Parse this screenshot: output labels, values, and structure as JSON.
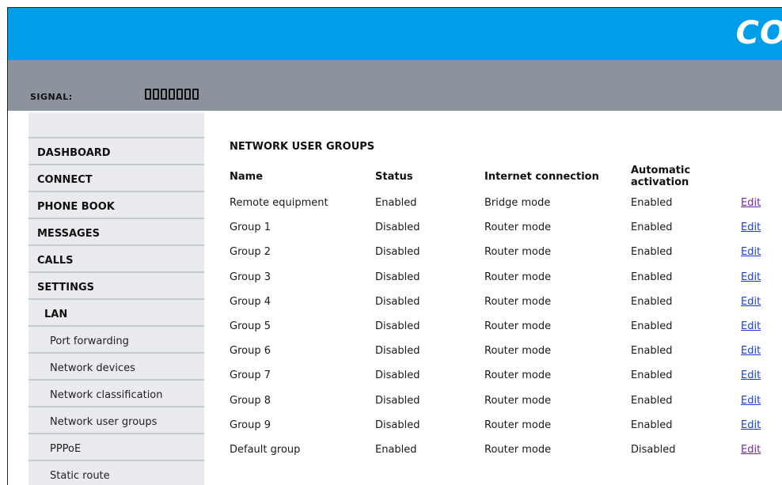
{
  "header": {
    "logo_text": "CO"
  },
  "signal": {
    "label": "SIGNAL:",
    "bars": 7
  },
  "sidebar": {
    "items": [
      {
        "label": "DASHBOARD",
        "level": 0
      },
      {
        "label": "CONNECT",
        "level": 0
      },
      {
        "label": "PHONE BOOK",
        "level": 0
      },
      {
        "label": "MESSAGES",
        "level": 0
      },
      {
        "label": "CALLS",
        "level": 0
      },
      {
        "label": "SETTINGS",
        "level": 0
      },
      {
        "label": "LAN",
        "level": 1
      },
      {
        "label": "Port forwarding",
        "level": 2
      },
      {
        "label": "Network devices",
        "level": 2
      },
      {
        "label": "Network classification",
        "level": 2
      },
      {
        "label": "Network user groups",
        "level": 2
      },
      {
        "label": "PPPoE",
        "level": 2
      },
      {
        "label": "Static route",
        "level": 2
      }
    ]
  },
  "main": {
    "title": "NETWORK USER GROUPS",
    "columns": [
      "Name",
      "Status",
      "Internet connection",
      "Automatic activation",
      ""
    ],
    "rows": [
      {
        "name": "Remote equipment",
        "status": "Enabled",
        "connection": "Bridge mode",
        "activation": "Enabled",
        "action": "Edit",
        "visited": true
      },
      {
        "name": "Group 1",
        "status": "Disabled",
        "connection": "Router mode",
        "activation": "Enabled",
        "action": "Edit",
        "visited": false
      },
      {
        "name": "Group 2",
        "status": "Disabled",
        "connection": "Router mode",
        "activation": "Enabled",
        "action": "Edit",
        "visited": false
      },
      {
        "name": "Group 3",
        "status": "Disabled",
        "connection": "Router mode",
        "activation": "Enabled",
        "action": "Edit",
        "visited": false
      },
      {
        "name": "Group 4",
        "status": "Disabled",
        "connection": "Router mode",
        "activation": "Enabled",
        "action": "Edit",
        "visited": false
      },
      {
        "name": "Group 5",
        "status": "Disabled",
        "connection": "Router mode",
        "activation": "Enabled",
        "action": "Edit",
        "visited": false
      },
      {
        "name": "Group 6",
        "status": "Disabled",
        "connection": "Router mode",
        "activation": "Enabled",
        "action": "Edit",
        "visited": false
      },
      {
        "name": "Group 7",
        "status": "Disabled",
        "connection": "Router mode",
        "activation": "Enabled",
        "action": "Edit",
        "visited": false
      },
      {
        "name": "Group 8",
        "status": "Disabled",
        "connection": "Router mode",
        "activation": "Enabled",
        "action": "Edit",
        "visited": false
      },
      {
        "name": "Group 9",
        "status": "Disabled",
        "connection": "Router mode",
        "activation": "Enabled",
        "action": "Edit",
        "visited": false
      },
      {
        "name": "Default group",
        "status": "Enabled",
        "connection": "Router mode",
        "activation": "Disabled",
        "action": "Edit",
        "visited": true
      }
    ]
  },
  "colors": {
    "header_blue": "#009ee8",
    "signal_gray": "#8c939d",
    "sidebar_bg": "#e9ebee",
    "link": "#1a3fd6",
    "link_visited": "#7b2a9e"
  }
}
